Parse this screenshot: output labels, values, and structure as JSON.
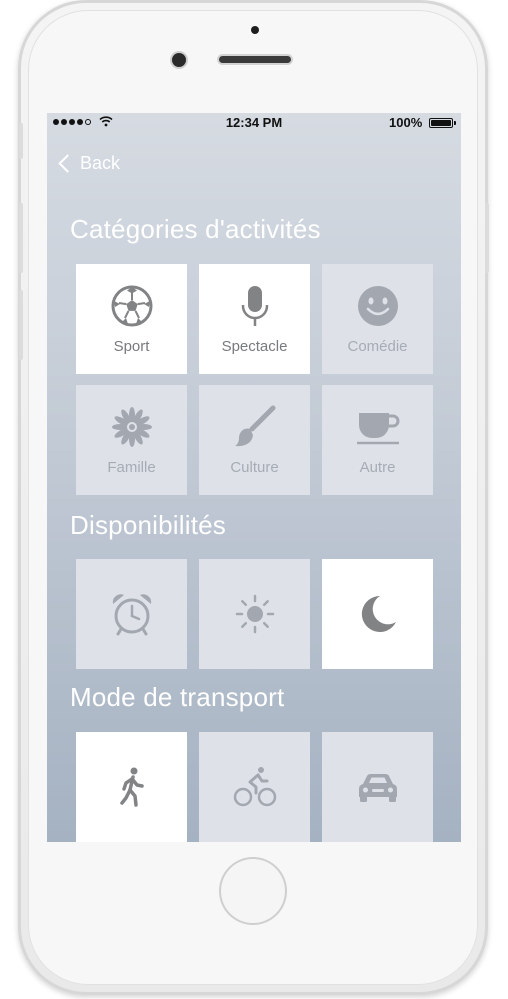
{
  "status_bar": {
    "time": "12:34 PM",
    "battery": "100%",
    "signal_icon": "signal-dots-icon",
    "wifi_icon": "wifi-icon",
    "battery_icon": "battery-icon"
  },
  "nav": {
    "back_label": "Back",
    "back_icon": "chevron-left-icon"
  },
  "sections": {
    "categories_title": "Catégories d'activités",
    "availability_title": "Disponibilités",
    "transport_title": "Mode de transport"
  },
  "categories": [
    {
      "label": "Sport",
      "icon": "soccer-ball-icon",
      "selected": true
    },
    {
      "label": "Spectacle",
      "icon": "microphone-icon",
      "selected": true
    },
    {
      "label": "Comédie",
      "icon": "smiley-icon",
      "selected": false
    },
    {
      "label": "Famille",
      "icon": "flower-icon",
      "selected": false
    },
    {
      "label": "Culture",
      "icon": "paintbrush-icon",
      "selected": false
    },
    {
      "label": "Autre",
      "icon": "cup-icon",
      "selected": false
    }
  ],
  "availability": [
    {
      "icon": "alarm-clock-icon",
      "selected": false
    },
    {
      "icon": "sun-icon",
      "selected": false
    },
    {
      "icon": "moon-icon",
      "selected": true
    }
  ],
  "transport": [
    {
      "icon": "walking-icon",
      "selected": true
    },
    {
      "icon": "bicycle-icon",
      "selected": false
    },
    {
      "icon": "car-icon",
      "selected": false
    }
  ],
  "colors": {
    "icon_active": "#828385",
    "icon_inactive": "#a3a8b0",
    "tile_selected": "#ffffff",
    "tile_unselected": "#dee2e8"
  }
}
